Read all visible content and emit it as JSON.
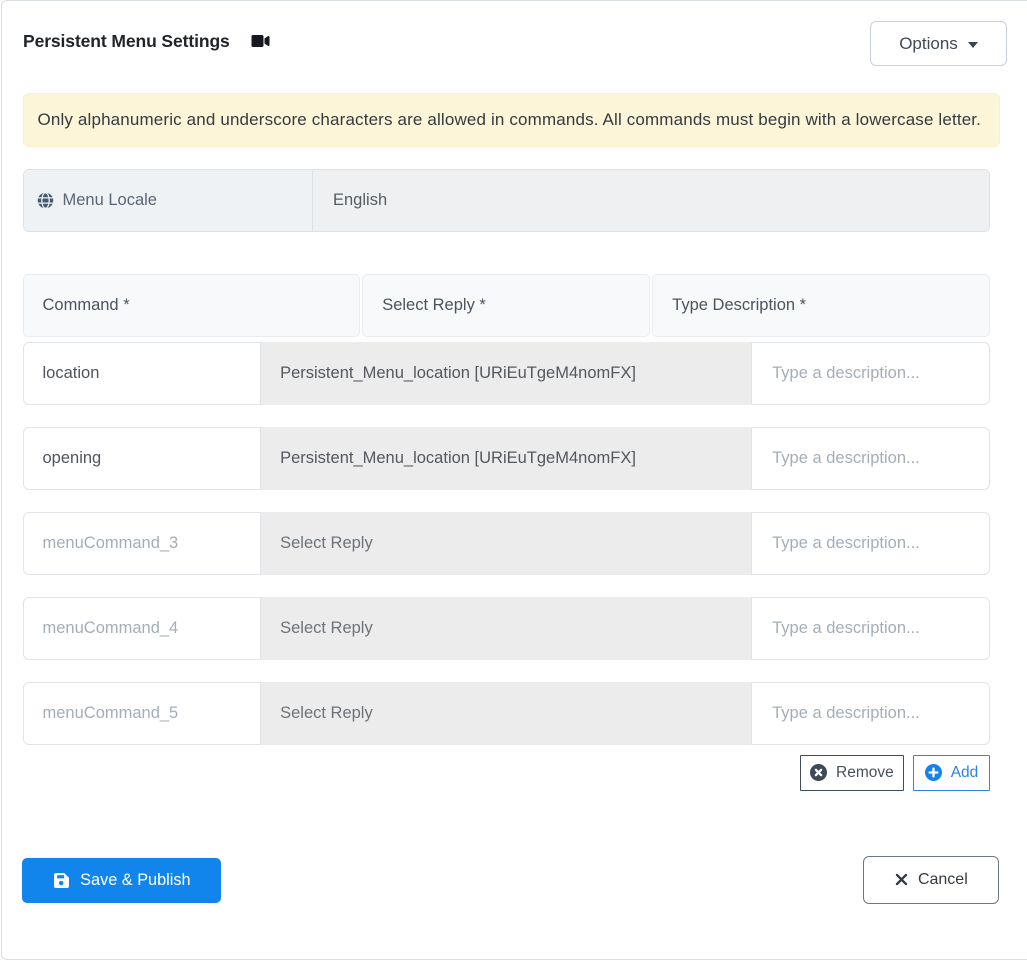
{
  "header": {
    "title": "Persistent Menu Settings",
    "options_label": "Options"
  },
  "alert": {
    "text": "Only alphanumeric and underscore characters are allowed in commands. All commands must begin with a lowercase letter."
  },
  "locale": {
    "label": "Menu Locale",
    "value": "English"
  },
  "table": {
    "columns": [
      "Command *",
      "Select Reply *",
      "Type Description *"
    ],
    "rows": [
      {
        "command_value": "location",
        "command_placeholder": "",
        "reply": "Persistent_Menu_location [URiEuTgeM4nomFX]",
        "description_placeholder": "Type a description..."
      },
      {
        "command_value": "opening",
        "command_placeholder": "",
        "reply": "Persistent_Menu_location [URiEuTgeM4nomFX]",
        "description_placeholder": "Type a description..."
      },
      {
        "command_value": "",
        "command_placeholder": "menuCommand_3",
        "reply": "Select Reply",
        "description_placeholder": "Type a description..."
      },
      {
        "command_value": "",
        "command_placeholder": "menuCommand_4",
        "reply": "Select Reply",
        "description_placeholder": "Type a description..."
      },
      {
        "command_value": "",
        "command_placeholder": "menuCommand_5",
        "reply": "Select Reply",
        "description_placeholder": "Type a description..."
      }
    ],
    "remove_label": "Remove",
    "add_label": "Add"
  },
  "footer": {
    "save_label": "Save & Publish",
    "cancel_label": "Cancel"
  },
  "colors": {
    "primary_blue": "#1185ec",
    "alert_bg": "#fdf5d7",
    "remove_dark": "#3f4c5a",
    "card_border": "#d9dee3"
  }
}
